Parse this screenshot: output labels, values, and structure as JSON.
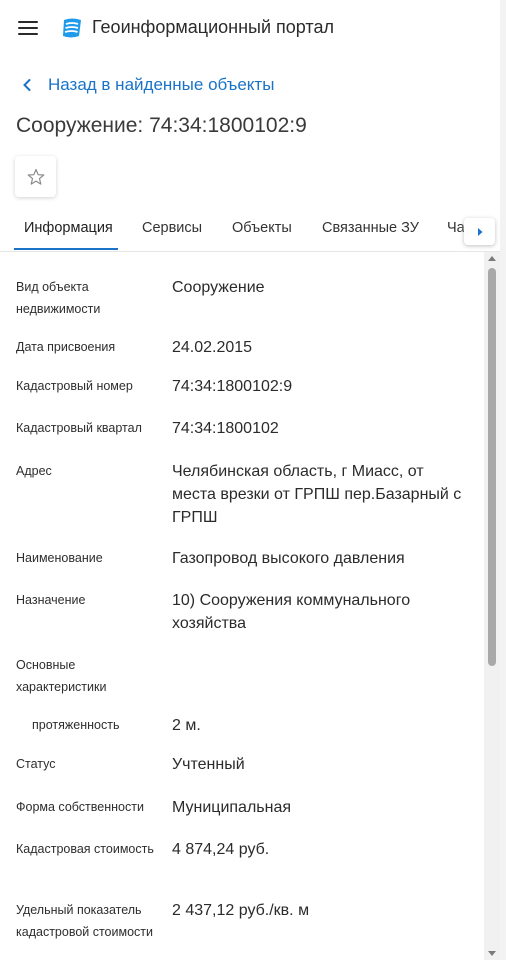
{
  "app": {
    "title": "Геоинформационный портал"
  },
  "back_link": {
    "label": "Назад в найденные объекты"
  },
  "page_title": "Сооружение: 74:34:1800102:9",
  "tabs": [
    {
      "label": "Информация",
      "active": true
    },
    {
      "label": "Сервисы"
    },
    {
      "label": "Объекты"
    },
    {
      "label": "Связанные ЗУ"
    },
    {
      "label": "Ча"
    }
  ],
  "info": [
    {
      "label": "Вид объекта недвижимости",
      "value": "Сооружение"
    },
    {
      "label": "Дата присвоения",
      "value": "24.02.2015"
    },
    {
      "label": "Кадастровый номер",
      "value": "74:34:1800102:9"
    },
    {
      "label": "Кадастровый квартал",
      "value": "74:34:1800102"
    },
    {
      "label": "Адрес",
      "value": "Челябинская область, г Миасс, от места врезки от ГРПШ пер.Базарный с ГРПШ"
    },
    {
      "label": "Наименование",
      "value": "Газопровод высокого давления"
    },
    {
      "label": "Назначение",
      "value": "10) Сооружения коммунального хозяйства"
    },
    {
      "label": "Основные характеристики",
      "value": ""
    },
    {
      "label": "протяженность",
      "value": "2 м."
    },
    {
      "label": "Статус",
      "value": "Учтенный"
    },
    {
      "label": "Форма собственности",
      "value": "Муниципальная"
    },
    {
      "label": "Кадастровая стоимость",
      "value": "4 874,24 руб."
    },
    {
      "label": "Удельный показатель кадастровой стоимости",
      "value": "2 437,12 руб./кв. м"
    }
  ],
  "colors": {
    "accent": "#1a73c8",
    "text": "#2b2b2b",
    "logo": "#1e9bea"
  },
  "icons": {
    "menu": "hamburger-menu-icon",
    "logo": "portal-logo-icon",
    "back": "chevron-left-icon",
    "favorite": "star-outline-icon",
    "tabs_next": "caret-right-icon"
  }
}
